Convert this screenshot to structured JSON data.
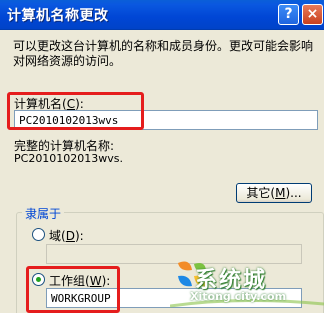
{
  "window": {
    "title": "计算机名称更改",
    "help_glyph": "?",
    "close_glyph": "×"
  },
  "description": "可以更改这台计算机的名称和成员身份。更改可能会影响对网络资源的访问。",
  "computer_name": {
    "label_prefix": "计算机名(",
    "label_key": "C",
    "label_suffix": "):",
    "value": "PC2010102013wvs"
  },
  "full_name": {
    "label": "完整的计算机名称:",
    "value": "PC2010102013wvs."
  },
  "more_button": {
    "label_prefix": "其它(",
    "label_key": "M",
    "label_suffix": ")..."
  },
  "member_of": {
    "label": "隶属于",
    "domain": {
      "label_prefix": "域(",
      "label_key": "D",
      "label_suffix": "):",
      "value": "",
      "selected": false
    },
    "workgroup": {
      "label_prefix": "工作组(",
      "label_key": "W",
      "label_suffix": "):",
      "value": "WORKGROUP",
      "selected": true
    }
  },
  "watermark": {
    "text": "系统城",
    "sub": "Xitong city.com"
  },
  "colors": {
    "highlight": "#e51d1d",
    "title_bar": "#0046d5",
    "group_label": "#0046d5"
  }
}
